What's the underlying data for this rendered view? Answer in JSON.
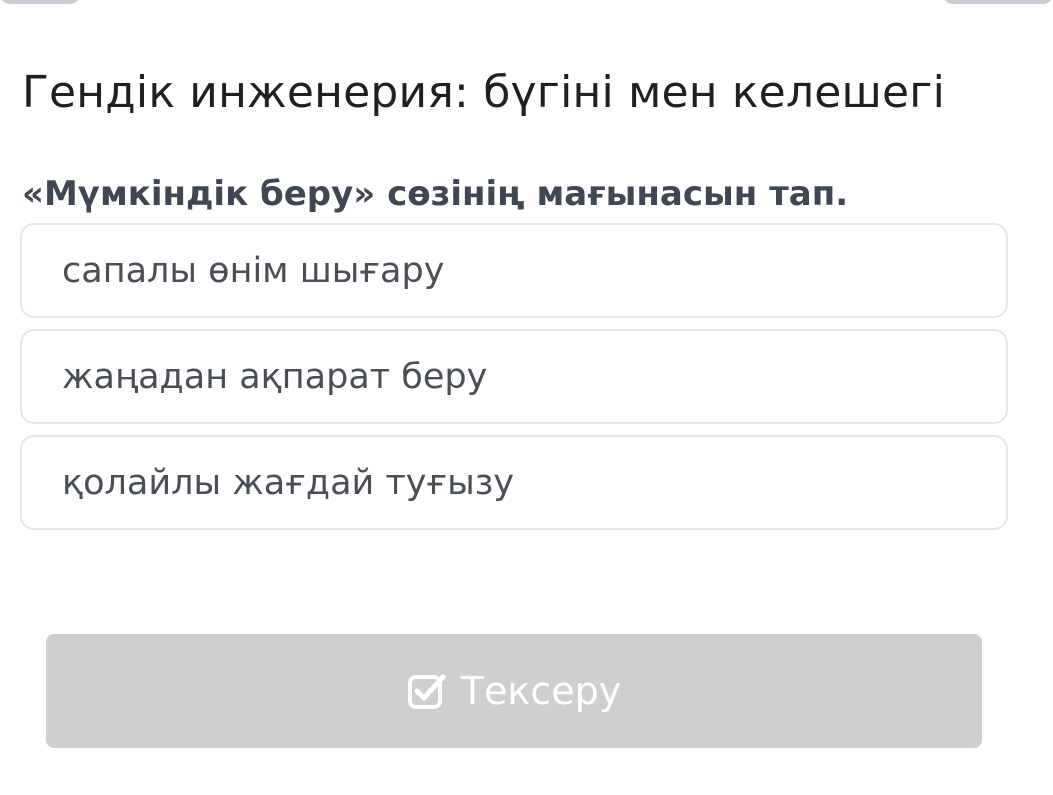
{
  "page": {
    "title": "Гендік инженерия: бүгіні мен келешегі"
  },
  "quiz": {
    "question": "«Мүмкіндік беру» сөзінің мағынасын тап.",
    "options": [
      {
        "label": "сапалы өнім шығару"
      },
      {
        "label": "жаңадан ақпарат беру"
      },
      {
        "label": "қолайлы жағдай туғызу"
      }
    ]
  },
  "actions": {
    "check_label": "Тексеру",
    "check_icon": "checkbox-check-icon",
    "button_color": "#cfcfcf"
  }
}
